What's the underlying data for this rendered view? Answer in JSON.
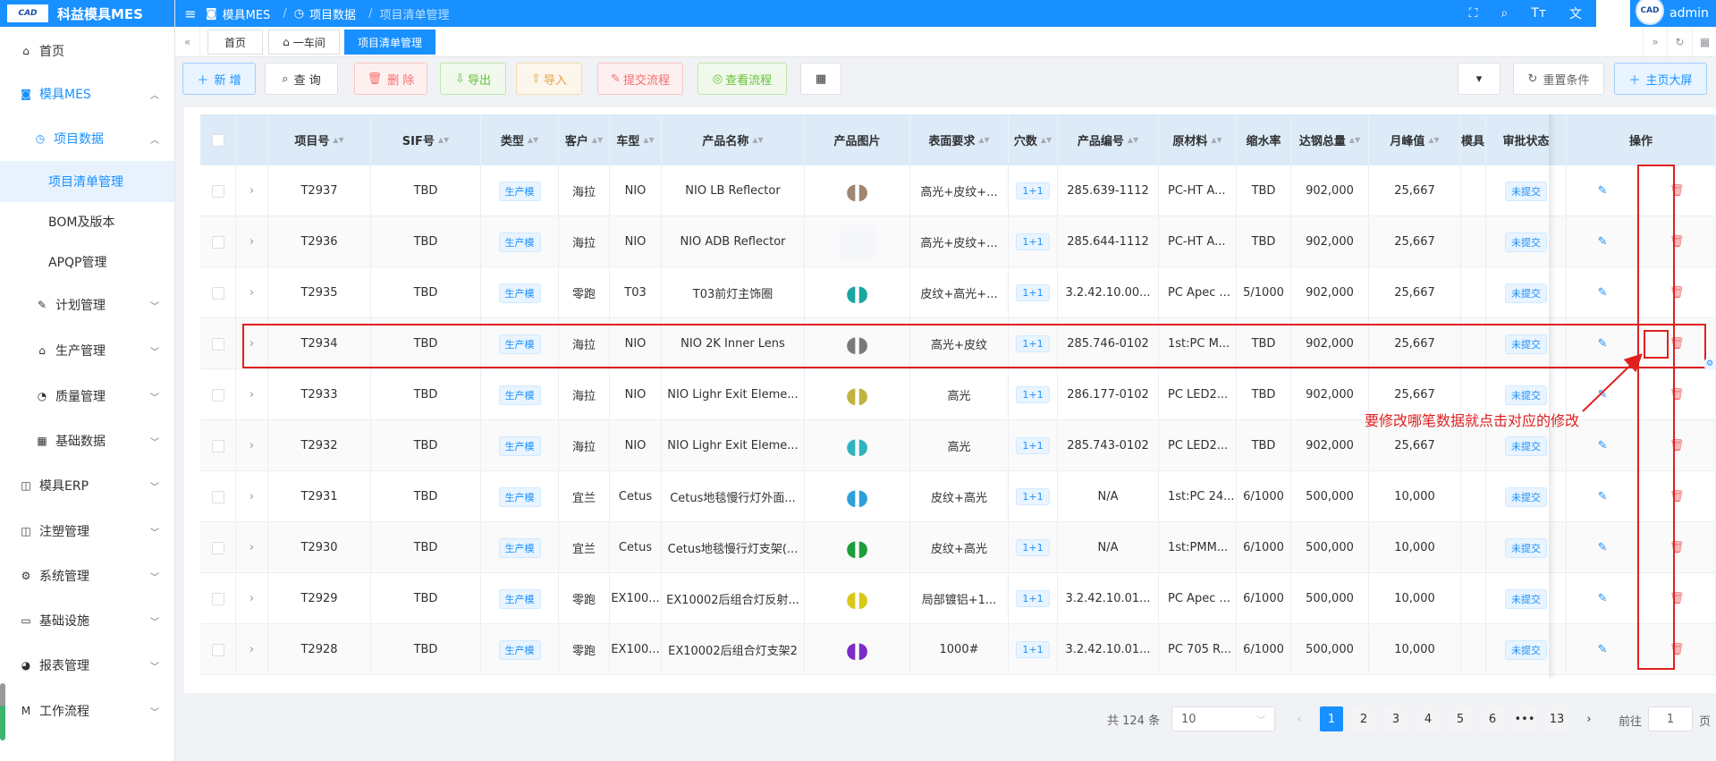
{
  "app": {
    "logo_text": "CAD",
    "title": "科益模具MES"
  },
  "topbar": {
    "breadcrumb": [
      "模具MES",
      "项目数据",
      "项目清单管理"
    ],
    "user": "admin"
  },
  "sidebar": {
    "items": [
      {
        "label": "首页"
      },
      {
        "label": "模具MES"
      },
      {
        "label": "项目数据"
      },
      {
        "label": "项目清单管理"
      },
      {
        "label": "BOM及版本"
      },
      {
        "label": "APQP管理"
      },
      {
        "label": "计划管理"
      },
      {
        "label": "生产管理"
      },
      {
        "label": "质量管理"
      },
      {
        "label": "基础数据"
      },
      {
        "label": "模具ERP"
      },
      {
        "label": "注塑管理"
      },
      {
        "label": "系统管理"
      },
      {
        "label": "基础设施"
      },
      {
        "label": "报表管理"
      },
      {
        "label": "工作流程"
      }
    ]
  },
  "tabs": [
    "首页",
    "一车间",
    "项目清单管理"
  ],
  "toolbar": {
    "add": "新 增",
    "query": "查 询",
    "delete": "删 除",
    "export": "导出",
    "import": "导入",
    "submit": "提交流程",
    "view": "查看流程",
    "reset": "重置条件",
    "big_screen": "主页大屏"
  },
  "table": {
    "headers": [
      "项目号",
      "SIF号",
      "类型",
      "客户",
      "车型",
      "产品名称",
      "产品图片",
      "表面要求",
      "穴数",
      "产品编号",
      "原材料",
      "缩水率",
      "达钢总量",
      "月峰值",
      "模具",
      "审批状态",
      "操作"
    ],
    "rows": [
      {
        "proj": "T2937",
        "sif": "TBD",
        "type": "生产模",
        "cust": "海拉",
        "car": "NIO",
        "name": "NIO LB Reflector",
        "surf": "高光+皮纹+...",
        "cav": "1+1",
        "pno": "285.639-1112",
        "mat": "PC-HT A...",
        "shrink": "TBD",
        "total": "902,000",
        "peak": "25,667",
        "status": "未提交"
      },
      {
        "proj": "T2936",
        "sif": "TBD",
        "type": "生产模",
        "cust": "海拉",
        "car": "NIO",
        "name": "NIO ADB Reflector",
        "surf": "高光+皮纹+...",
        "cav": "1+1",
        "pno": "285.644-1112",
        "mat": "PC-HT A...",
        "shrink": "TBD",
        "total": "902,000",
        "peak": "25,667",
        "status": "未提交"
      },
      {
        "proj": "T2935",
        "sif": "TBD",
        "type": "生产模",
        "cust": "零跑",
        "car": "T03",
        "name": "T03前灯主饰圈",
        "surf": "皮纹+高光+...",
        "cav": "1+1",
        "pno": "3.2.42.10.00...",
        "mat": "PC Apec ...",
        "shrink": "5/1000",
        "total": "902,000",
        "peak": "25,667",
        "status": "未提交"
      },
      {
        "proj": "T2934",
        "sif": "TBD",
        "type": "生产模",
        "cust": "海拉",
        "car": "NIO",
        "name": "NIO 2K Inner Lens",
        "surf": "高光+皮纹",
        "cav": "1+1",
        "pno": "285.746-0102",
        "mat": "1st:PC M...",
        "shrink": "TBD",
        "total": "902,000",
        "peak": "25,667",
        "status": "未提交"
      },
      {
        "proj": "T2933",
        "sif": "TBD",
        "type": "生产模",
        "cust": "海拉",
        "car": "NIO",
        "name": "NIO Lighr Exit Eleme...",
        "surf": "高光",
        "cav": "1+1",
        "pno": "286.177-0102",
        "mat": "PC LED2...",
        "shrink": "TBD",
        "total": "902,000",
        "peak": "25,667",
        "status": "未提交"
      },
      {
        "proj": "T2932",
        "sif": "TBD",
        "type": "生产模",
        "cust": "海拉",
        "car": "NIO",
        "name": "NIO Lighr Exit Eleme...",
        "surf": "高光",
        "cav": "1+1",
        "pno": "285.743-0102",
        "mat": "PC LED2...",
        "shrink": "TBD",
        "total": "902,000",
        "peak": "25,667",
        "status": "未提交"
      },
      {
        "proj": "T2931",
        "sif": "TBD",
        "type": "生产模",
        "cust": "宜兰",
        "car": "Cetus",
        "name": "Cetus地毯慢行灯外面...",
        "surf": "皮纹+高光",
        "cav": "1+1",
        "pno": "N/A",
        "mat": "1st:PC 24...",
        "shrink": "6/1000",
        "total": "500,000",
        "peak": "10,000",
        "status": "未提交"
      },
      {
        "proj": "T2930",
        "sif": "TBD",
        "type": "生产模",
        "cust": "宜兰",
        "car": "Cetus",
        "name": "Cetus地毯慢行灯支架(...",
        "surf": "皮纹+高光",
        "cav": "1+1",
        "pno": "N/A",
        "mat": "1st:PMM...",
        "shrink": "6/1000",
        "total": "500,000",
        "peak": "10,000",
        "status": "未提交"
      },
      {
        "proj": "T2929",
        "sif": "TBD",
        "type": "生产模",
        "cust": "零跑",
        "car": "EX100...",
        "name": "EX10002后组合灯反射...",
        "surf": "局部镀铝+1...",
        "cav": "1+1",
        "pno": "3.2.42.10.01...",
        "mat": "PC Apec ...",
        "shrink": "6/1000",
        "total": "500,000",
        "peak": "10,000",
        "status": "未提交"
      },
      {
        "proj": "T2928",
        "sif": "TBD",
        "type": "生产模",
        "cust": "零跑",
        "car": "EX100...",
        "name": "EX10002后组合灯支架2",
        "surf": "1000#",
        "cav": "1+1",
        "pno": "3.2.42.10.01...",
        "mat": "PC 705 R...",
        "shrink": "6/1000",
        "total": "500,000",
        "peak": "10,000",
        "status": "未提交"
      }
    ],
    "thumb_colors": [
      "#a08670",
      "",
      "#1aa6a0",
      "#7a7a7a",
      "#c2b240",
      "#2fb4bf",
      "#2ea0d8",
      "#1e9e3a",
      "#d8c818",
      "#7a2cc8"
    ]
  },
  "annotation": {
    "text": "要修改哪笔数据就点击对应的修改",
    "color": "#e02020"
  },
  "pagination": {
    "total": "共 124 条",
    "page_size": "10",
    "pages": [
      "1",
      "2",
      "3",
      "4",
      "5",
      "6",
      "•••",
      "13"
    ],
    "goto_label": "前往",
    "goto_value": "1",
    "page_suffix": "页"
  }
}
